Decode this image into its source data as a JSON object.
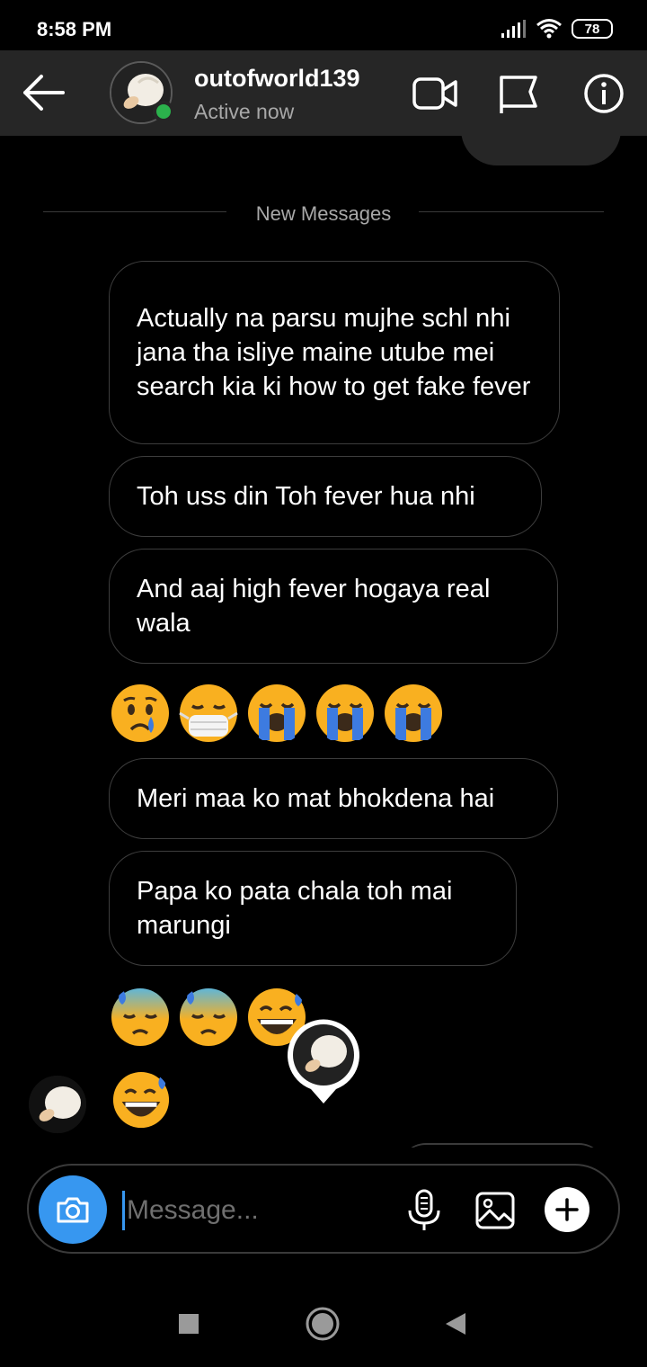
{
  "status_bar": {
    "time": "8:58 PM",
    "battery": "78"
  },
  "header": {
    "username": "outofworld139",
    "status": "Active now"
  },
  "divider": {
    "label": "New Messages"
  },
  "messages": [
    "Actually na parsu mujhe schl nhi jana tha isliye maine utube mei search kia ki how to get fake fever",
    "Toh uss din Toh fever hua nhi",
    "And aaj high fever hogaya real wala",
    "Meri maa ko mat bhokdena hai",
    "Papa ko pata chala toh mai marungi"
  ],
  "emoji_rows": [
    [
      "crying-face",
      "face-with-medical-mask",
      "loudly-crying-face",
      "loudly-crying-face",
      "loudly-crying-face"
    ],
    [
      "downcast-face-with-sweat",
      "downcast-face-with-sweat",
      "grinning-face-with-sweat"
    ],
    [
      "grinning-face-with-sweat"
    ]
  ],
  "composer": {
    "placeholder": "Message..."
  },
  "colors": {
    "accent": "#3797f0",
    "online": "#2bb24c",
    "header_bg": "#262626",
    "bubble_border": "#3d3d3d"
  }
}
